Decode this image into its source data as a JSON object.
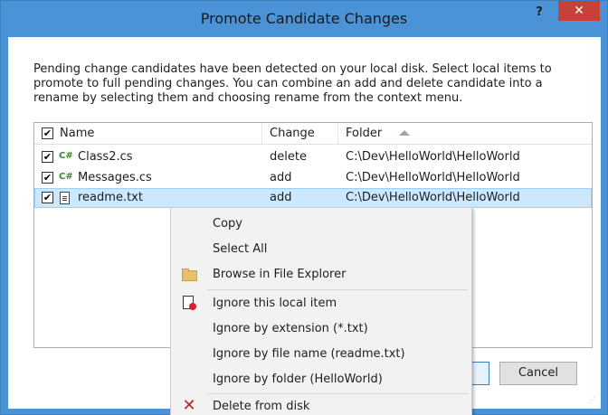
{
  "window": {
    "title": "Promote Candidate Changes",
    "help_label": "?",
    "close_label": "✕"
  },
  "description": "Pending change candidates have been detected on your local disk. Select local items to promote to full pending changes. You can combine an add and delete candidate into a rename by selecting them and choosing rename from the context menu.",
  "grid": {
    "columns": {
      "name": "Name",
      "change": "Change",
      "folder": "Folder"
    },
    "rows": [
      {
        "name": "Class2.cs",
        "change": "delete",
        "folder": "C:\\Dev\\HelloWorld\\HelloWorld",
        "icon": "csharp-file-icon",
        "checked": true
      },
      {
        "name": "Messages.cs",
        "change": "add",
        "folder": "C:\\Dev\\HelloWorld\\HelloWorld",
        "icon": "csharp-file-icon",
        "checked": true
      },
      {
        "name": "readme.txt",
        "change": "add",
        "folder": "C:\\Dev\\HelloWorld\\HelloWorld",
        "icon": "text-file-icon",
        "checked": true,
        "selected": true
      }
    ]
  },
  "buttons": {
    "cancel": "Cancel"
  },
  "context_menu": {
    "items": [
      {
        "label": "Copy"
      },
      {
        "label": "Select All"
      },
      {
        "label": "Browse in File Explorer",
        "icon": "folder-icon"
      },
      {
        "label": "Ignore this local item",
        "icon": "ignore-file-icon"
      },
      {
        "label": "Ignore by extension (*.txt)"
      },
      {
        "label": "Ignore by file name (readme.txt)"
      },
      {
        "label": "Ignore by folder (HelloWorld)"
      },
      {
        "label": "Delete from disk",
        "icon": "delete-x-icon"
      }
    ]
  },
  "glyphs": {
    "check": "✔",
    "csharp": "C#"
  },
  "colors": {
    "titlebar": "#4a93d6",
    "close": "#c7413a",
    "selection": "#cce8ff"
  }
}
